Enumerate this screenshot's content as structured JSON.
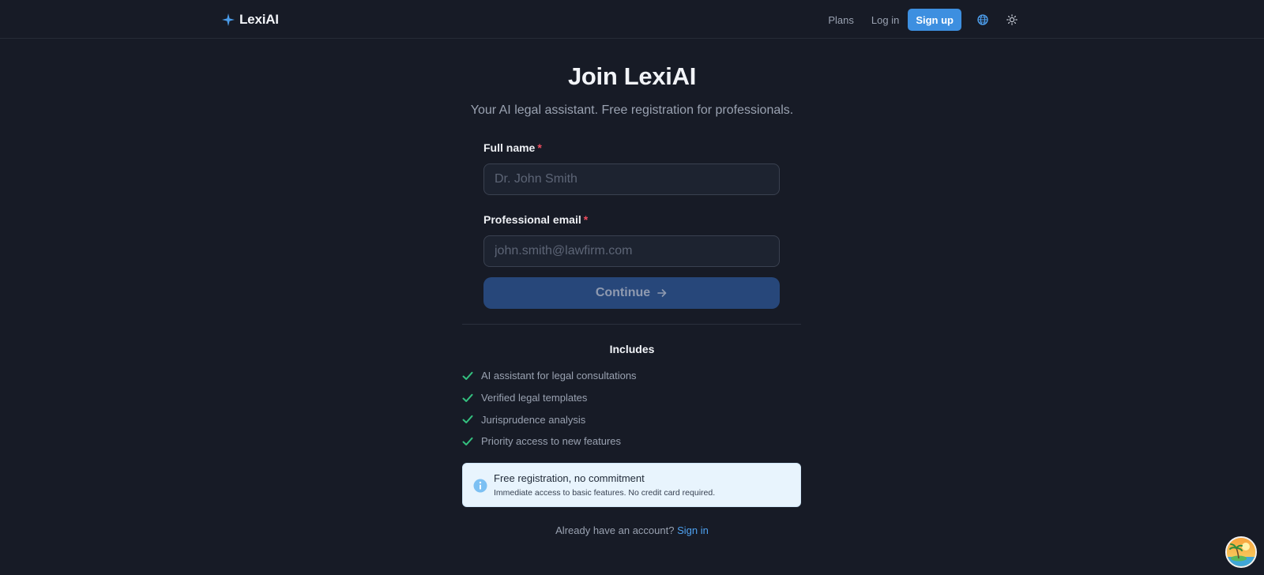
{
  "header": {
    "brand": "LexiAI",
    "nav": {
      "plans": "Plans",
      "login": "Log in",
      "signup": "Sign up"
    },
    "icons": [
      "sparkle-icon",
      "globe-icon",
      "sun-icon"
    ]
  },
  "page": {
    "title": "Join LexiAI",
    "subtitle": "Your AI legal assistant. Free registration for professionals."
  },
  "form": {
    "full_name": {
      "label": "Full name",
      "required_mark": "*",
      "placeholder": "Dr. John Smith",
      "value": ""
    },
    "email": {
      "label": "Professional email",
      "required_mark": "*",
      "placeholder": "john.smith@lawfirm.com",
      "value": ""
    },
    "continue_label": "Continue"
  },
  "includes": {
    "title": "Includes",
    "items": [
      "AI assistant for legal consultations",
      "Verified legal templates",
      "Jurisprudence analysis",
      "Priority access to new features"
    ]
  },
  "notice": {
    "title": "Free registration, no commitment",
    "text": "Immediate access to basic features. No credit card required."
  },
  "footer": {
    "prompt": "Already have an account?",
    "link": "Sign in"
  },
  "colors": {
    "background": "#171b26",
    "accent": "#3d8fe0",
    "continue_bg": "#27477a",
    "check": "#34c07f",
    "required": "#ee4d5f",
    "notice_bg": "#e8f4fd"
  }
}
